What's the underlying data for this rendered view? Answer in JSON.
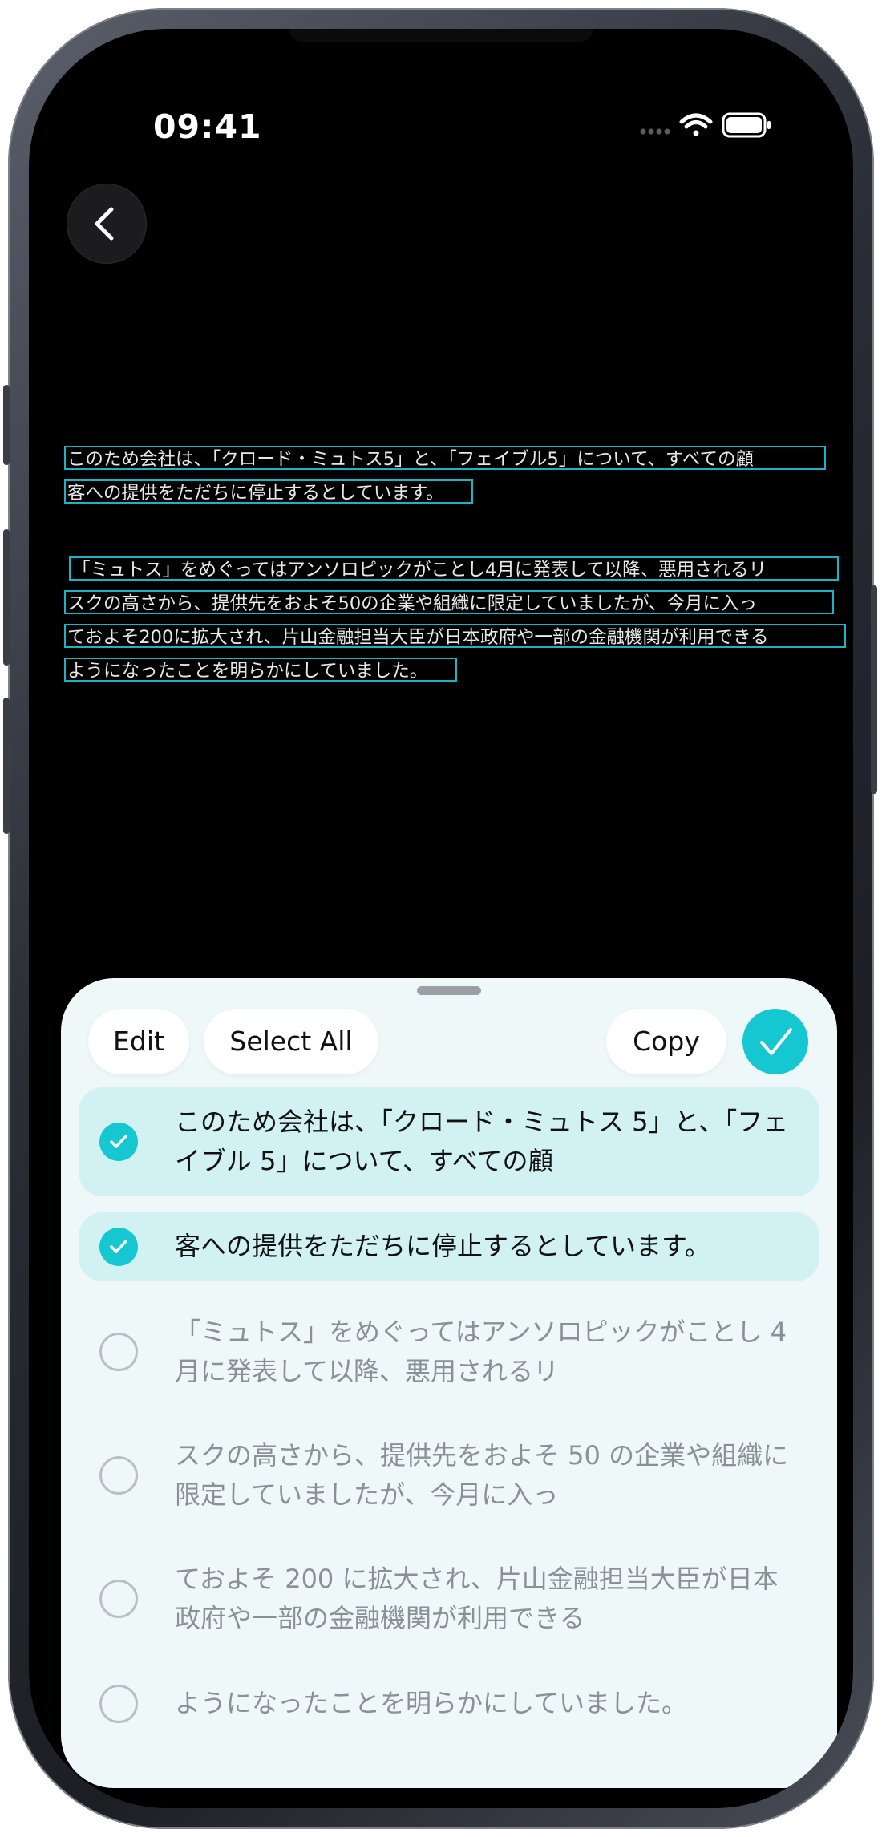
{
  "status_bar": {
    "time": "09:41",
    "icons": [
      "signal-dots-icon",
      "wifi-icon",
      "battery-icon"
    ]
  },
  "nav": {
    "back_icon": "chevron-left-icon"
  },
  "recognized_text": {
    "lines": [
      "このため会社は、「クロード・ミュトス5」と、「フェイブル5」について、すべての顧",
      "客への提供をただちに停止するとしています。",
      "「ミュトス」をめぐってはアンソロピックがことし4月に発表して以降、悪用されるリ",
      "スクの高さから、提供先をおよそ50の企業や組織に限定していましたが、今月に入っ",
      "ておよそ200に拡大され、片山金融担当大臣が日本政府や一部の金融機関が利用できる",
      "ようになったことを明らかにしていました。"
    ]
  },
  "sheet": {
    "toolbar": {
      "edit_label": "Edit",
      "select_all_label": "Select All",
      "copy_label": "Copy",
      "done_icon": "checkmark-icon"
    },
    "items": [
      {
        "text": "このため会社は、「クロード・ミュトス 5」と、「フェイブル 5」について、すべての顧",
        "selected": true
      },
      {
        "text": "客への提供をただちに停止するとしています。",
        "selected": true
      },
      {
        "text": "「ミュトス」をめぐってはアンソロピックがことし 4 月に発表して以降、悪用されるリ",
        "selected": false
      },
      {
        "text": "スクの高さから、提供先をおよそ 50 の企業や組織に限定していましたが、今月に入っ",
        "selected": false
      },
      {
        "text": "ておよそ 200 に拡大され、片山金融担当大臣が日本政府や一部の金融機関が利用できる",
        "selected": false
      },
      {
        "text": "ようになったことを明らかにしていました。",
        "selected": false
      }
    ]
  },
  "colors": {
    "accent": "#14c7d1",
    "selected_row": "#d2f1f3",
    "sheet_bg": "#eef8f9",
    "ocr_box": "#1cb3c2"
  }
}
